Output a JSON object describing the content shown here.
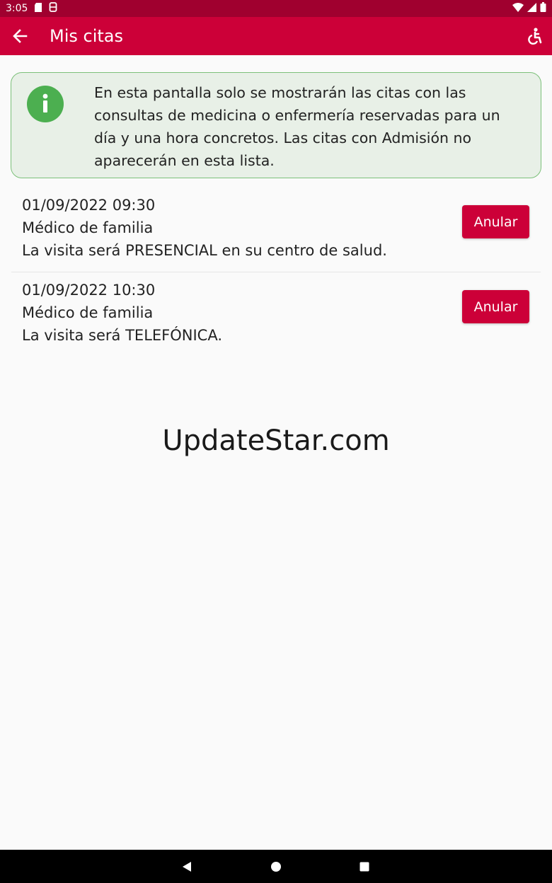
{
  "status_bar": {
    "time": "3:05",
    "icons_left": [
      "sd-card-icon",
      "app-notification-icon"
    ],
    "icons_right": [
      "wifi-icon",
      "signal-icon",
      "battery-icon"
    ]
  },
  "app_bar": {
    "title": "Mis citas",
    "back_icon": "arrow-back-icon",
    "accessibility_icon": "accessibility-icon",
    "color": "#cc0038"
  },
  "info": {
    "icon": "info-icon",
    "text": "En esta pantalla solo se mostrarán las citas con las consultas de medicina o enfermería reservadas para un día y una hora concretos. Las citas con Admisión no aparecerán en esta lista."
  },
  "appointments": [
    {
      "datetime": "01/09/2022 09:30",
      "service": "Médico de familia",
      "mode": "La visita será PRESENCIAL en su centro de salud.",
      "button": "Anular"
    },
    {
      "datetime": "01/09/2022 10:30",
      "service": "Médico de familia",
      "mode": "La visita será TELEFÓNICA.",
      "button": "Anular"
    }
  ],
  "watermark": "UpdateStar.com",
  "nav_bar": {
    "icons": [
      "back-triangle-icon",
      "home-circle-icon",
      "recents-square-icon"
    ]
  }
}
